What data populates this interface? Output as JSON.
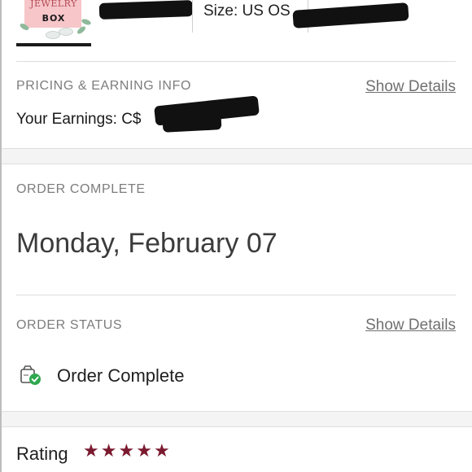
{
  "product": {
    "thumb_line1": "JEWELRY",
    "thumb_line2": "BOX",
    "size_text": "Size: US OS"
  },
  "pricing": {
    "section_label": "PRICING & EARNING INFO",
    "show_details_label": "Show Details",
    "earnings_label": "Your Earnings: C$"
  },
  "order_complete": {
    "section_label": "ORDER COMPLETE",
    "date": "Monday, February 07"
  },
  "order_status": {
    "section_label": "ORDER STATUS",
    "show_details_label": "Show Details",
    "status_text": "Order Complete",
    "icon": "order-complete-icon",
    "check_color": "#2fa84f"
  },
  "rating": {
    "label": "Rating",
    "stars": 5,
    "max_stars": 5,
    "star_color": "#7b1a2f"
  }
}
